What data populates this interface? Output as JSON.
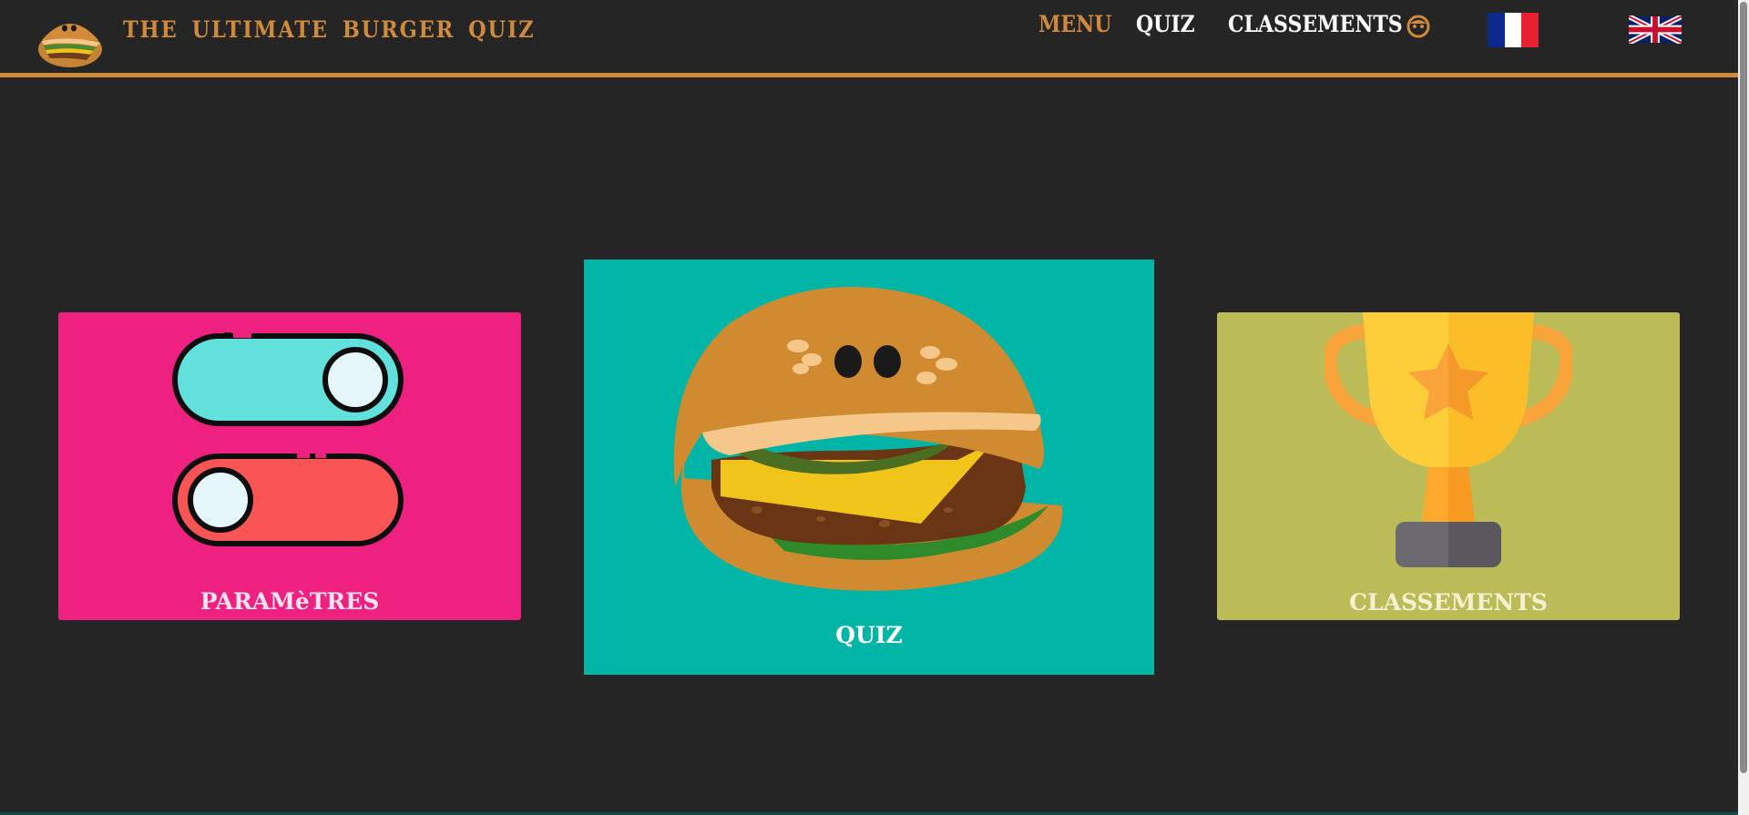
{
  "header": {
    "site_title": "THE ULTIMATE BURGER QUIZ",
    "nav": {
      "menu": "MENU",
      "quiz": "QUIZ",
      "classements": "CLASSEMENTS"
    },
    "languages": [
      "fr",
      "en"
    ]
  },
  "cards": {
    "parametres": {
      "label": "PARAMèTRES",
      "color": "#ee2080"
    },
    "quiz": {
      "label": "QUIZ",
      "color": "#00b5a5"
    },
    "classements": {
      "label": "CLASSEMENTS",
      "color": "#bbbb58"
    }
  },
  "colors": {
    "background": "#252525",
    "accent": "#d08a3c"
  },
  "icons": [
    "burger-logo-icon",
    "user-face-icon",
    "france-flag-icon",
    "uk-flag-icon",
    "toggle-switches-icon",
    "burger-icon",
    "trophy-icon"
  ]
}
